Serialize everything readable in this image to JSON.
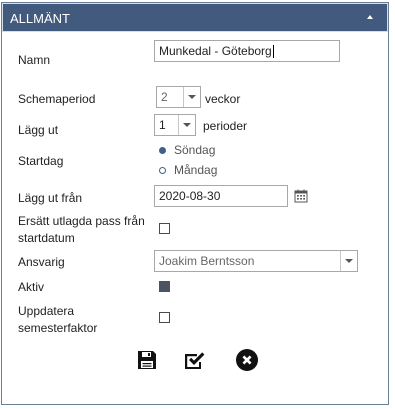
{
  "panel": {
    "title": "ALLMÄNT",
    "header_color": "#415a7d"
  },
  "form": {
    "name": {
      "label": "Namn",
      "value": "Munkedal - Göteborg"
    },
    "schedule_period": {
      "label": "Schemaperiod",
      "value": "2",
      "suffix": "veckor"
    },
    "publish": {
      "label": "Lägg ut",
      "value": "1",
      "suffix": "perioder"
    },
    "start_day": {
      "label": "Startdag",
      "options": [
        "Söndag",
        "Måndag"
      ],
      "selected": "Söndag"
    },
    "publish_from": {
      "label": "Lägg ut från",
      "value": "2020-08-30"
    },
    "replace_shifts": {
      "label_line1": "Ersätt utlagda pass från",
      "label_line2": "startdatum",
      "checked": false
    },
    "responsible": {
      "label": "Ansvarig",
      "value": "Joakim Berntsson"
    },
    "active": {
      "label": "Aktiv",
      "checked": true
    },
    "update_vacation": {
      "label_line1": "Uppdatera",
      "label_line2": "semesterfaktor",
      "checked": false
    }
  },
  "actions": {
    "icons": [
      "save-icon",
      "checkmark-edit-icon",
      "close-circle-icon"
    ]
  }
}
